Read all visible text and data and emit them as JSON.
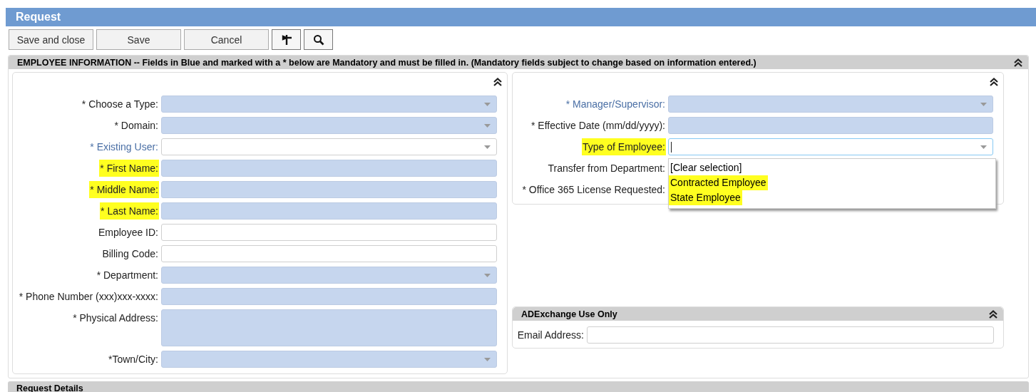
{
  "window": {
    "title": "Request"
  },
  "toolbar": {
    "buttons": [
      "Save and close",
      "Save",
      "Cancel"
    ]
  },
  "employee_information": {
    "header": "EMPLOYEE INFORMATION -- Fields in Blue and marked with a * below are Mandatory and must be filled in. (Mandatory fields subject to change based on information entered.)",
    "left_fields": [
      {
        "label": "* Choose a Type:",
        "kind": "select",
        "required": true,
        "blue_label": false,
        "highlighted": false
      },
      {
        "label": "* Domain:",
        "kind": "select",
        "required": true,
        "blue_label": false,
        "highlighted": false
      },
      {
        "label": "* Existing User:",
        "kind": "select",
        "required": false,
        "blue_label": true,
        "highlighted": false
      },
      {
        "label": "* First Name",
        "suffix": ":",
        "kind": "text",
        "required": true,
        "blue_label": false,
        "highlighted": true
      },
      {
        "label": "* Middle Name:",
        "kind": "text",
        "required": true,
        "blue_label": false,
        "highlighted": true
      },
      {
        "label": "* Last Name:",
        "kind": "text",
        "required": true,
        "blue_label": false,
        "highlighted": true
      },
      {
        "label": "Employee ID:",
        "kind": "text",
        "required": false,
        "blue_label": false,
        "highlighted": false
      },
      {
        "label": "Billing Code:",
        "kind": "text",
        "required": false,
        "blue_label": false,
        "highlighted": false
      },
      {
        "label": "* Department:",
        "kind": "select",
        "required": true,
        "blue_label": false,
        "highlighted": false
      },
      {
        "label": "* Phone Number (xxx)xxx-xxxx:",
        "kind": "text",
        "required": true,
        "blue_label": false,
        "highlighted": false
      },
      {
        "label": "* Physical Address:",
        "kind": "textarea",
        "required": true,
        "blue_label": false,
        "highlighted": false
      },
      {
        "label": "*Town/City:",
        "kind": "select",
        "required": true,
        "blue_label": false,
        "highlighted": false
      }
    ],
    "right_fields": [
      {
        "label": "* Manager/Supervisor:",
        "kind": "select",
        "required": true,
        "blue_label": true,
        "highlighted": false
      },
      {
        "label": "* Effective Date (mm/dd/yyyy):",
        "kind": "text",
        "required": true,
        "blue_label": false,
        "highlighted": false
      },
      {
        "label": "Type of Employee:",
        "kind": "select",
        "required": false,
        "blue_label": false,
        "highlighted": true,
        "focused": true,
        "options": [
          {
            "label": "[Clear selection]",
            "highlighted": false
          },
          {
            "label": "Contracted Employee",
            "highlighted": true
          },
          {
            "label": "State Employee",
            "highlighted": true
          }
        ]
      },
      {
        "label": "Transfer from Department:",
        "kind": "covered",
        "blue_label": false,
        "highlighted": false
      },
      {
        "label": "* Office 365 License Requested:",
        "kind": "covered",
        "blue_label": false,
        "highlighted": false
      }
    ]
  },
  "adexchange": {
    "header": "ADExchange Use Only",
    "fields": [
      {
        "label": "Email Address:",
        "kind": "text",
        "required": false,
        "blue_label": false,
        "highlighted": false
      }
    ]
  },
  "request_details": {
    "header": "Request Details"
  }
}
